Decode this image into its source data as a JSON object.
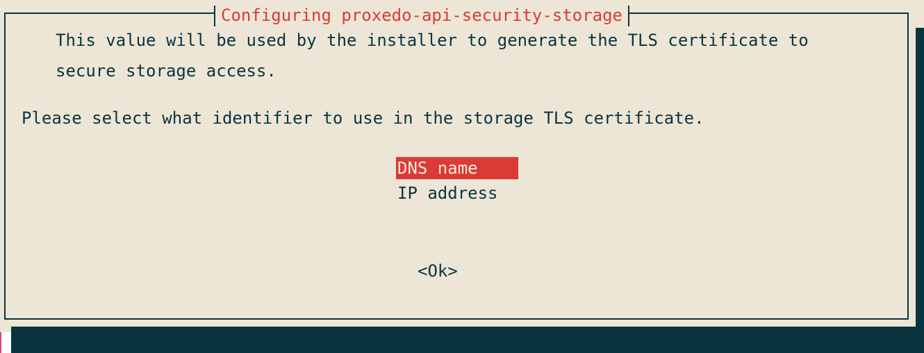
{
  "dialog": {
    "title": "Configuring proxedo-api-security-storage",
    "description_line1": "This value will be used by the installer to generate the TLS certificate to",
    "description_line2": "secure storage access.",
    "prompt": "Please select what identifier to use in the storage TLS certificate.",
    "options": [
      {
        "label": "DNS name",
        "selected": true
      },
      {
        "label": "IP address",
        "selected": false
      }
    ],
    "ok_label": "<Ok>"
  },
  "colors": {
    "background": "#ede6d6",
    "frame": "#0b3440",
    "shadow": "#09343e",
    "title": "#dc3a36",
    "selection": "#dc3a36",
    "selection_text": "#f5eedc"
  }
}
